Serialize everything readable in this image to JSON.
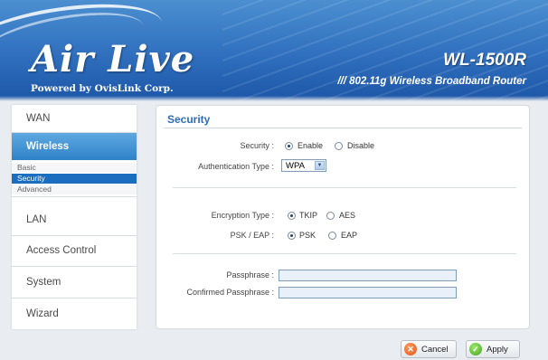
{
  "brand": {
    "logo": "Air Live",
    "tagline": "Powered by OvisLink Corp.",
    "model": "WL-1500R",
    "model_subtitle": "/// 802.11g Wireless Broadband Router"
  },
  "sidebar": {
    "items": [
      {
        "label": "WAN"
      },
      {
        "label": "Wireless"
      },
      {
        "label": "LAN"
      },
      {
        "label": "Access Control"
      },
      {
        "label": "System"
      },
      {
        "label": "Wizard"
      }
    ],
    "wireless_sub": [
      {
        "label": "Basic"
      },
      {
        "label": "Security"
      },
      {
        "label": "Advanced"
      }
    ]
  },
  "panel": {
    "title": "Security",
    "security_label": "Security :",
    "security_enable": "Enable",
    "security_disable": "Disable",
    "auth_label": "Authentication Type :",
    "auth_value": "WPA",
    "enc_label": "Encryption Type :",
    "enc_tkip": "TKIP",
    "enc_aes": "AES",
    "psk_label": "PSK / EAP :",
    "psk_psk": "PSK",
    "psk_eap": "EAP",
    "pass_label": "Passphrase :",
    "conf_label": "Confirmed Passphrase :"
  },
  "buttons": {
    "cancel": "Cancel",
    "apply": "Apply"
  },
  "colors": {
    "accent": "#2f82c9",
    "title": "#2d6db4"
  }
}
